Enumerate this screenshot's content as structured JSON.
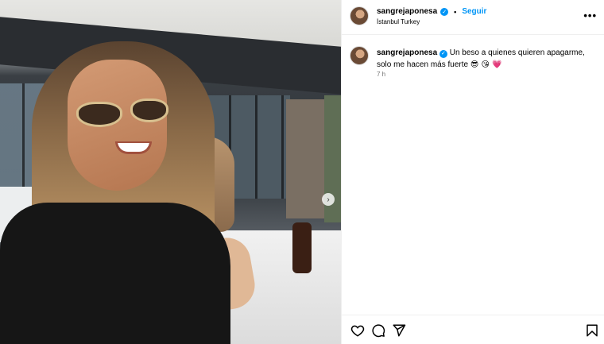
{
  "post": {
    "username": "sangrejaponesa",
    "follow_label": "Seguir",
    "separator": "•",
    "location": "İstanbul Turkey",
    "more_label": "•••",
    "caption_text": "Un beso a quienes quieren apagarme, solo me hacen más fuerte",
    "caption_emojis": "😎 😘 💗",
    "time_ago": "7 h",
    "carousel_next_label": "›"
  },
  "icons": {
    "verified": "verified-badge-icon",
    "like": "heart-icon",
    "comment": "comment-icon",
    "share": "paper-plane-icon",
    "save": "bookmark-icon",
    "more": "more-horizontal-icon",
    "carousel_next": "chevron-right-icon"
  },
  "colors": {
    "accent": "#0095f6",
    "muted_text": "#737373",
    "border": "#efefef"
  }
}
